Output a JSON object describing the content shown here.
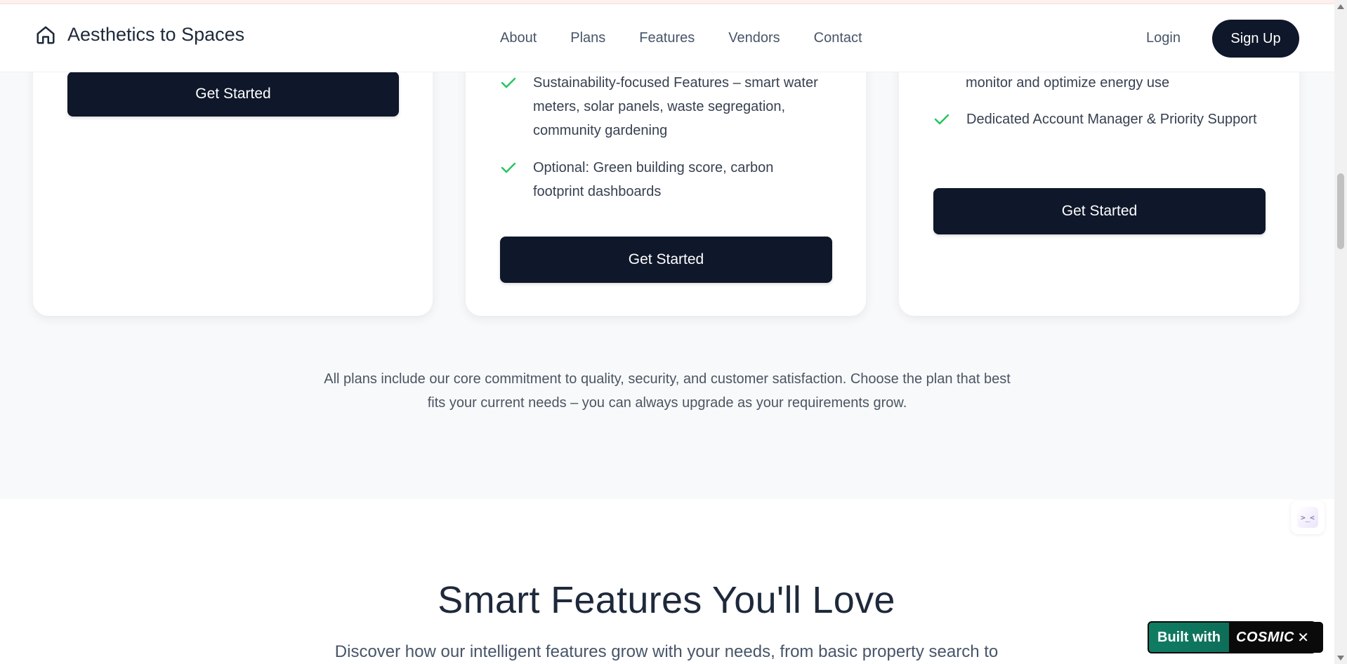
{
  "navbar": {
    "brand": "Aesthetics to Spaces",
    "links": [
      "About",
      "Plans",
      "Features",
      "Vendors",
      "Contact"
    ],
    "login": "Login",
    "signup": "Sign Up"
  },
  "pricing": {
    "cards": [
      {
        "features": [],
        "cta": "Get Started"
      },
      {
        "features": [
          "Sustainability-focused Features – smart water meters, solar panels, waste segregation, community gardening",
          "Optional: Green building score, carbon footprint dashboards"
        ],
        "cta": "Get Started"
      },
      {
        "features": [
          "monitor and optimize energy use",
          "Dedicated Account Manager & Priority Support"
        ],
        "cta": "Get Started"
      }
    ],
    "note": "All plans include our core commitment to quality, security, and customer satisfaction. Choose the plan that best fits your current needs – you can always upgrade as your requirements grow."
  },
  "features_section": {
    "title": "Smart Features You'll Love",
    "subtitle": "Discover how our intelligent features grow with your needs, from basic property search to"
  },
  "widget": {
    "face": ">_<"
  },
  "badge": {
    "label": "Built with",
    "logo": "COSMIC",
    "close": "✕"
  },
  "colors": {
    "primary_dark": "#0f172a",
    "check_green": "#22c55e",
    "badge_green": "#0f7d63"
  }
}
